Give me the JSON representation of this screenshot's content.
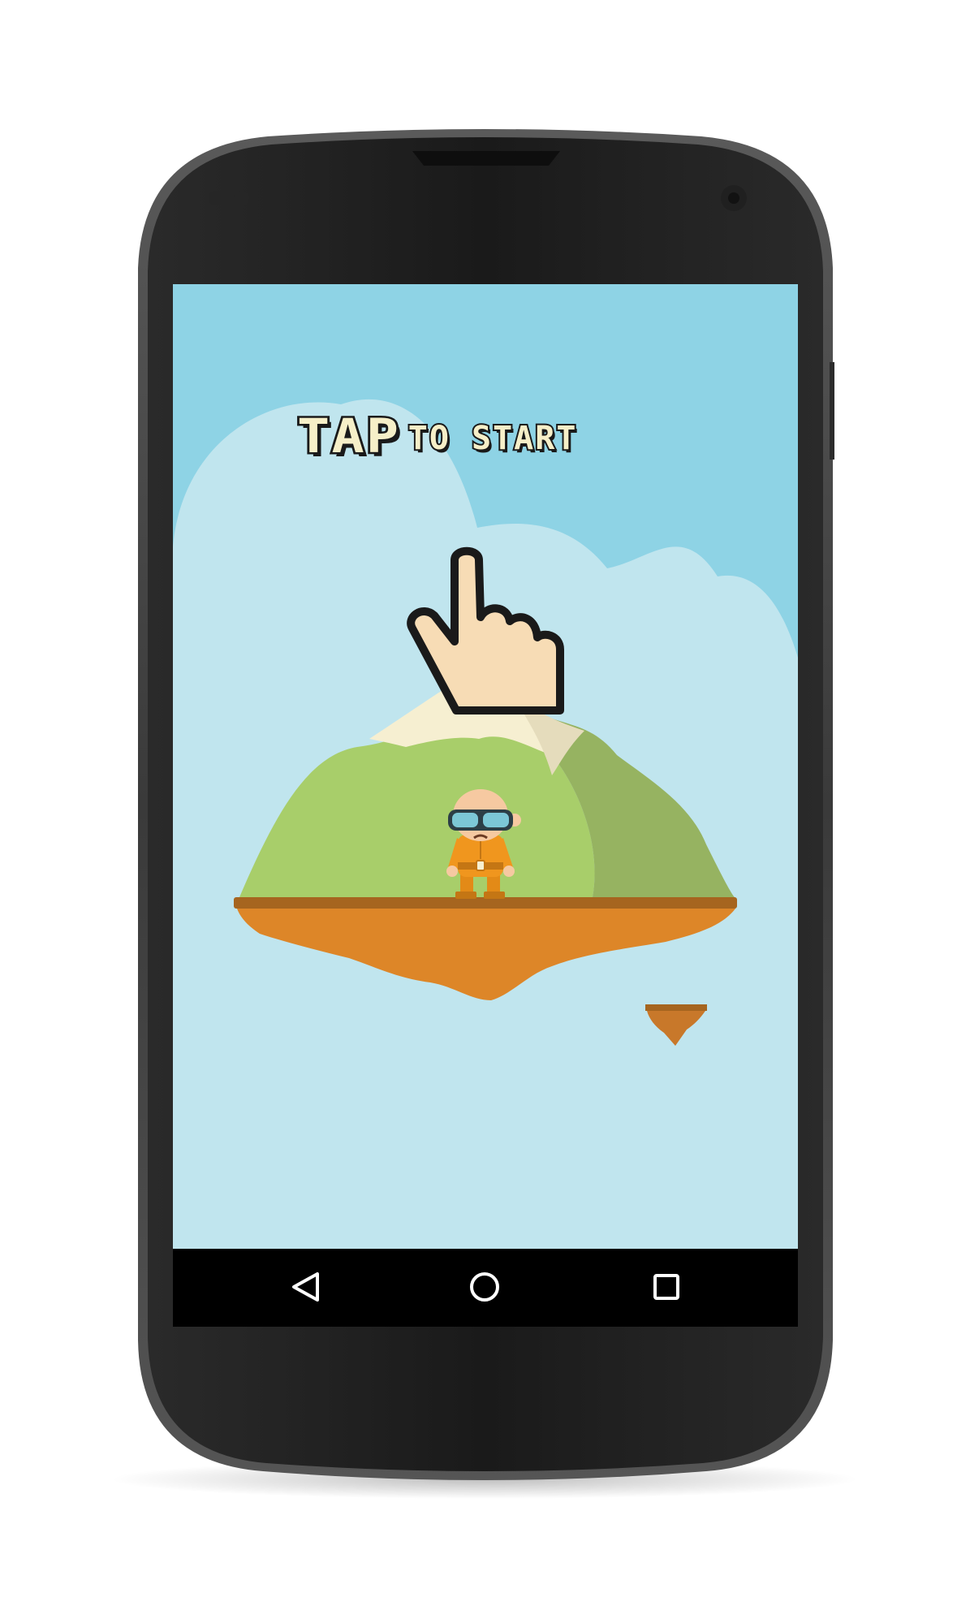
{
  "screen": {
    "title_big": "TAP",
    "title_small": "TO START"
  },
  "navbar": {
    "back_icon": "triangle-back-icon",
    "home_icon": "circle-home-icon",
    "recents_icon": "square-recents-icon"
  },
  "colors": {
    "sky": "#8ed3e5",
    "cloud": "#c0e5ee",
    "grass_light": "#a8ce6a",
    "grass_dark": "#96b361",
    "snow": "#f6efd1",
    "ground": "#dd8628",
    "ground_edge": "#a6651f",
    "hand_fill": "#f7dcb5",
    "suit": "#f0961e",
    "goggles": "#7cc7d6"
  }
}
